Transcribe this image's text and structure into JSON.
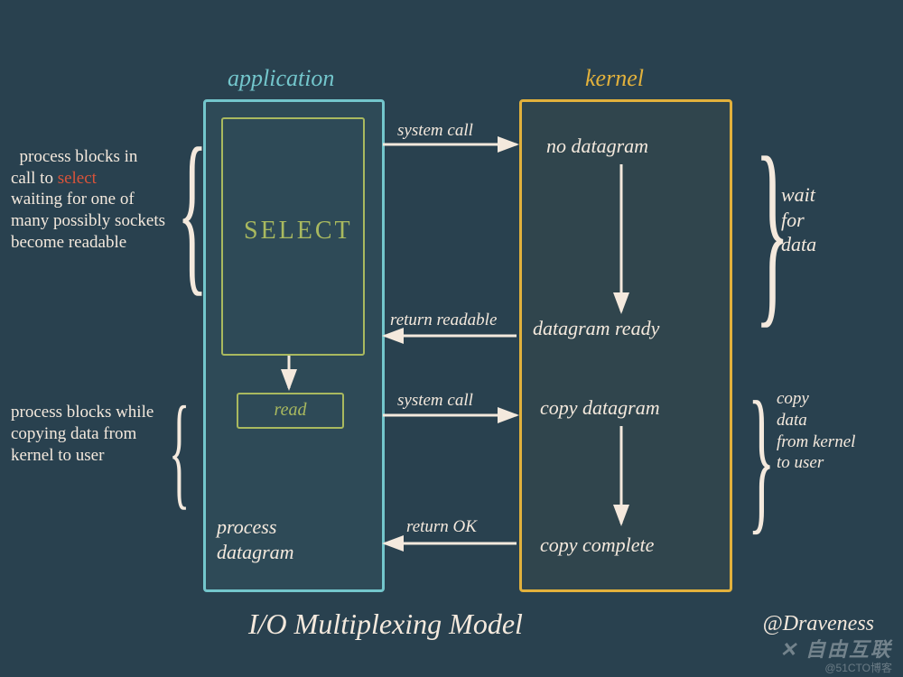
{
  "titles": {
    "application": "application",
    "kernel": "kernel"
  },
  "app_box": {
    "select": "SELECT",
    "read": "read",
    "process_datagram": "process\ndatagram"
  },
  "kernel_box": {
    "no_datagram": "no datagram",
    "datagram_ready": "datagram ready",
    "copy_datagram": "copy datagram",
    "copy_complete": "copy complete"
  },
  "arrows": {
    "syscall1": "system call",
    "return_readable": "return readable",
    "syscall2": "system call",
    "return_ok": "return OK"
  },
  "left_notes": {
    "note1_pre": "process blocks in\ncall to ",
    "note1_select": "select",
    "note1_post": "\nwaiting for one of\nmany possibly sockets\nbecome readable",
    "note2": "process blocks while\ncopying data from\nkernel to user"
  },
  "right_notes": {
    "note1": "wait\nfor\ndata",
    "note2": "copy\ndata\nfrom kernel\nto user"
  },
  "caption": "I/O Multiplexing Model",
  "author": "@Draveness",
  "watermark": {
    "line1": "✕ 自由互联",
    "line2": "@51CTO博客"
  }
}
